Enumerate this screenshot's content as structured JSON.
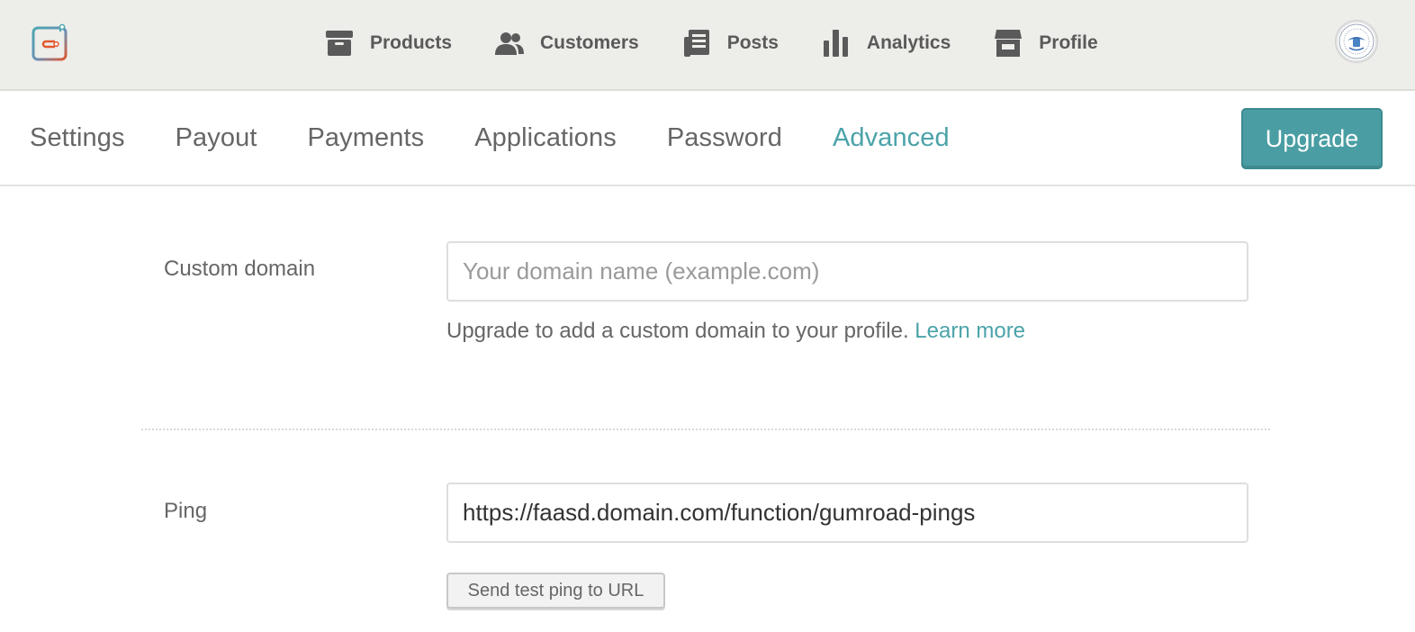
{
  "topnav": {
    "items": [
      {
        "label": "Products",
        "icon": "archive-box-icon"
      },
      {
        "label": "Customers",
        "icon": "users-icon"
      },
      {
        "label": "Posts",
        "icon": "newspaper-icon"
      },
      {
        "label": "Analytics",
        "icon": "bar-chart-icon"
      },
      {
        "label": "Profile",
        "icon": "storefront-icon"
      }
    ]
  },
  "tabs": [
    {
      "label": "Settings",
      "active": false
    },
    {
      "label": "Payout",
      "active": false
    },
    {
      "label": "Payments",
      "active": false
    },
    {
      "label": "Applications",
      "active": false
    },
    {
      "label": "Password",
      "active": false
    },
    {
      "label": "Advanced",
      "active": true
    }
  ],
  "upgrade_button": "Upgrade",
  "custom_domain": {
    "label": "Custom domain",
    "placeholder": "Your domain name (example.com)",
    "value": "",
    "help_text": "Upgrade to add a custom domain to your profile.",
    "learn_more": "Learn more"
  },
  "ping": {
    "label": "Ping",
    "value": "https://faasd.domain.com/function/gumroad-pings",
    "test_button": "Send test ping to URL"
  },
  "colors": {
    "accent": "#4ba3a9",
    "topbar_bg": "#ededea",
    "upgrade_bg": "#4a9ea3"
  }
}
